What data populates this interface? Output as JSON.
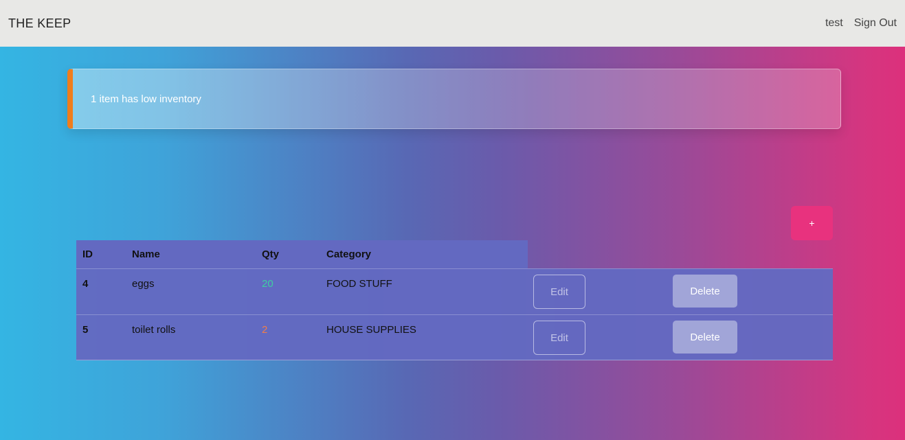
{
  "app": {
    "title": "THE KEEP"
  },
  "nav": {
    "user": "test",
    "sign_out": "Sign Out"
  },
  "alert": {
    "message": "1 item has low inventory",
    "accent_color": "#f07d1c"
  },
  "add_button": {
    "label": "+"
  },
  "table": {
    "headers": [
      "ID",
      "Name",
      "Qty",
      "Category"
    ],
    "rows": [
      {
        "id": "4",
        "name": "eggs",
        "qty": "20",
        "qty_color": "#3ecfa0",
        "category": "FOOD STUFF",
        "edit": "Edit",
        "delete": "Delete"
      },
      {
        "id": "5",
        "name": "toilet rolls",
        "qty": "2",
        "qty_color": "#f07d4a",
        "category": "HOUSE SUPPLIES",
        "edit": "Edit",
        "delete": "Delete"
      }
    ]
  }
}
